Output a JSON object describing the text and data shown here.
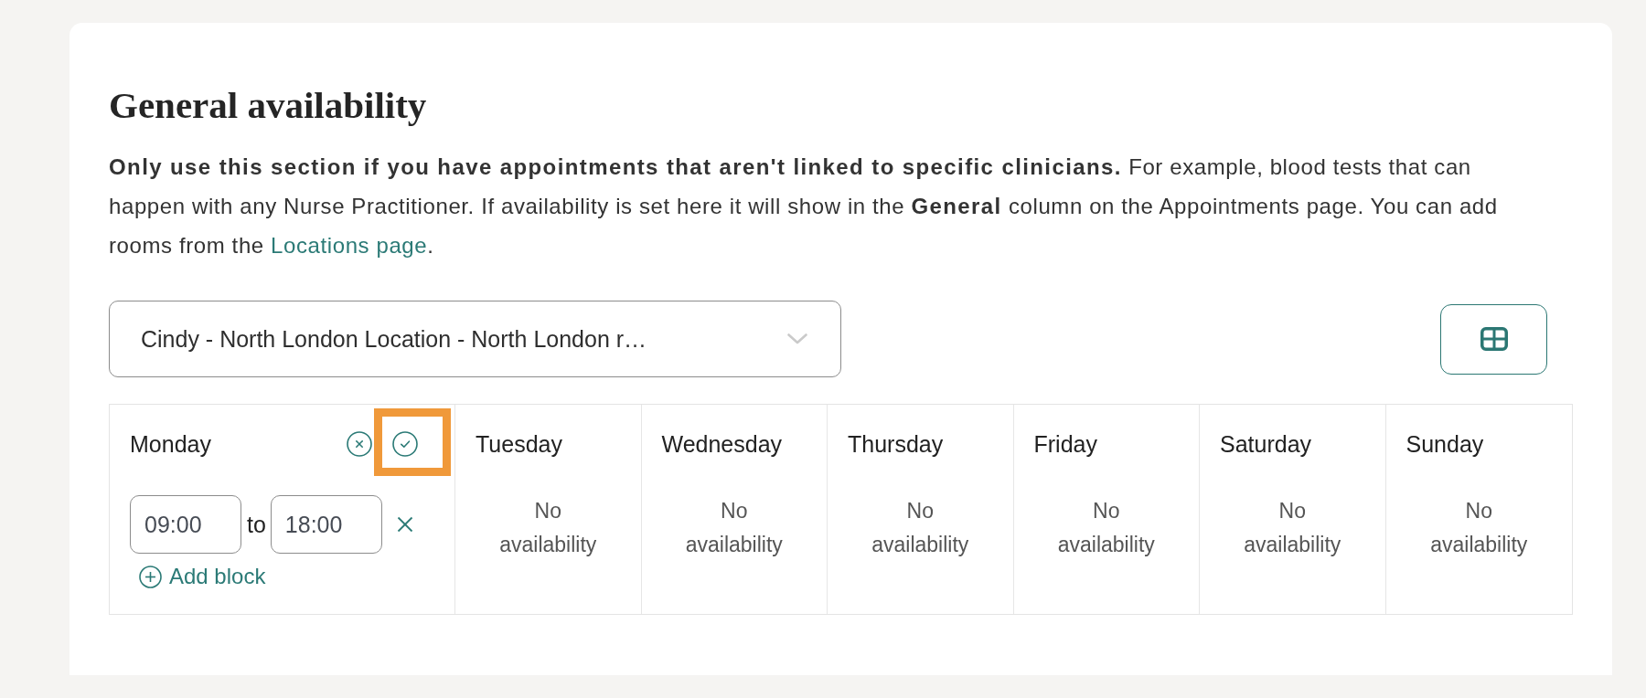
{
  "section": {
    "title": "General availability",
    "description": {
      "text": "**Only use this section if you have appointments that aren't linked to specific clinicians.** For example, blood tests that can happen with any Nurse Practitioner. If availability is set here it will show in the **General** column on the Appointments page. You can add rooms from the ",
      "link": "Locations page",
      "after_link": "."
    }
  },
  "location_select": {
    "value": "Cindy - North London Location - North London r…"
  },
  "days": [
    {
      "name": "Monday",
      "kind": "editing",
      "highlight_confirm": true,
      "blocks": [
        {
          "start": "09:00",
          "separator": "to",
          "end": "18:00"
        }
      ],
      "add_label": "Add block"
    },
    {
      "name": "Tuesday",
      "kind": "empty",
      "empty_text": "No availability"
    },
    {
      "name": "Wednesday",
      "kind": "empty",
      "empty_text": "No availability"
    },
    {
      "name": "Thursday",
      "kind": "empty",
      "empty_text": "No availability"
    },
    {
      "name": "Friday",
      "kind": "empty",
      "empty_text": "No availability"
    },
    {
      "name": "Saturday",
      "kind": "empty",
      "empty_text": "No availability"
    },
    {
      "name": "Sunday",
      "kind": "empty",
      "empty_text": "No availability"
    }
  ]
}
